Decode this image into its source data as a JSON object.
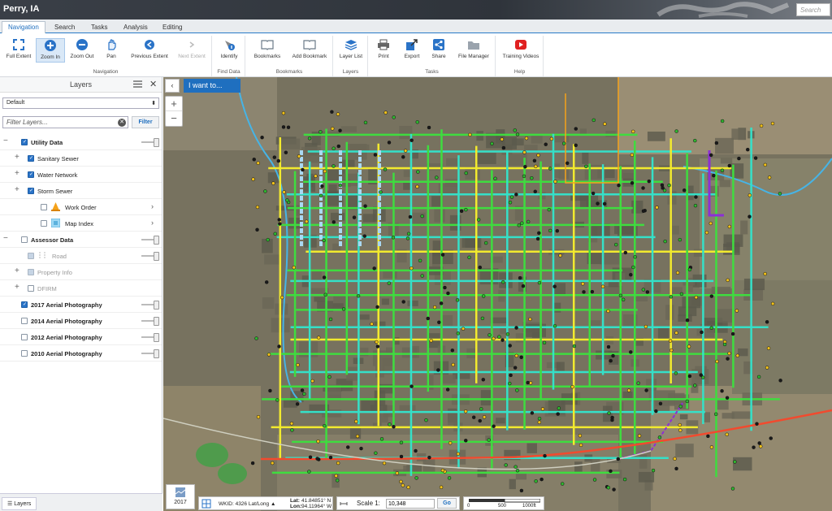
{
  "app": {
    "title": "Perry, IA",
    "search_placeholder": "Search ..."
  },
  "tabs": [
    "Navigation",
    "Search",
    "Tasks",
    "Analysis",
    "Editing"
  ],
  "ribbon": {
    "navigation": {
      "label": "Navigation",
      "buttons": [
        "Full Extent",
        "Zoom In",
        "Zoom Out",
        "Pan",
        "Previous Extent",
        "Next Extent"
      ]
    },
    "find_data": {
      "label": "Find Data",
      "buttons": [
        "Identify"
      ]
    },
    "bookmarks": {
      "label": "Bookmarks",
      "buttons": [
        "Bookmarks",
        "Add Bookmark"
      ]
    },
    "layers": {
      "label": "Layers",
      "buttons": [
        "Layer List"
      ]
    },
    "tasks": {
      "label": "Tasks",
      "buttons": [
        "Print",
        "Export",
        "Share",
        "File Manager"
      ]
    },
    "help": {
      "label": "Help",
      "buttons": [
        "Training Videos"
      ]
    }
  },
  "panel": {
    "title": "Layers",
    "preset": "Default",
    "filter_placeholder": "Filter Layers...",
    "filter_button": "Filter",
    "layers": [
      {
        "name": "Utility Data",
        "checked": true,
        "bold": true,
        "expanded": true
      },
      {
        "name": "Sanitary Sewer",
        "checked": true
      },
      {
        "name": "Water Network",
        "checked": true
      },
      {
        "name": "Storm Sewer",
        "checked": true
      },
      {
        "name": "Work Order",
        "checked": false
      },
      {
        "name": "Map Index",
        "checked": false
      },
      {
        "name": "Assessor Data",
        "checked": false,
        "bold": true,
        "expanded": true
      },
      {
        "name": "Road",
        "checked": true
      },
      {
        "name": "Property Info",
        "checked": true
      },
      {
        "name": "DFIRM",
        "checked": false
      },
      {
        "name": "2017 Aerial Photography",
        "checked": true,
        "bold": true
      },
      {
        "name": "2014 Aerial Photography",
        "checked": false,
        "bold": true
      },
      {
        "name": "2012 Aerial Photography",
        "checked": false,
        "bold": true
      },
      {
        "name": "2010 Aerial Photography",
        "checked": false,
        "bold": true
      }
    ],
    "bottom_tab": "Layers"
  },
  "map": {
    "i_want_to": "I want to...",
    "basemap_year": "2017",
    "wkid": "WKID: 4326 Lat/Long ▲",
    "lat": "41.84851° N",
    "lon": "94.11964° W",
    "lat_label": "Lat:",
    "lon_label": "Lon:",
    "scale_label": "Scale 1:",
    "scale_value": "10,348",
    "go": "Go",
    "scalebar_labels": [
      "0",
      "500",
      "1000ft"
    ]
  },
  "colors": {
    "accent": "#1f6fbf",
    "water": "#35e0c8",
    "sewer": "#3fdc3f",
    "storm": "#f2ea2e",
    "force_main": "#8c2fd6",
    "road": "#f24a2e",
    "stream": "#46b4e6"
  }
}
